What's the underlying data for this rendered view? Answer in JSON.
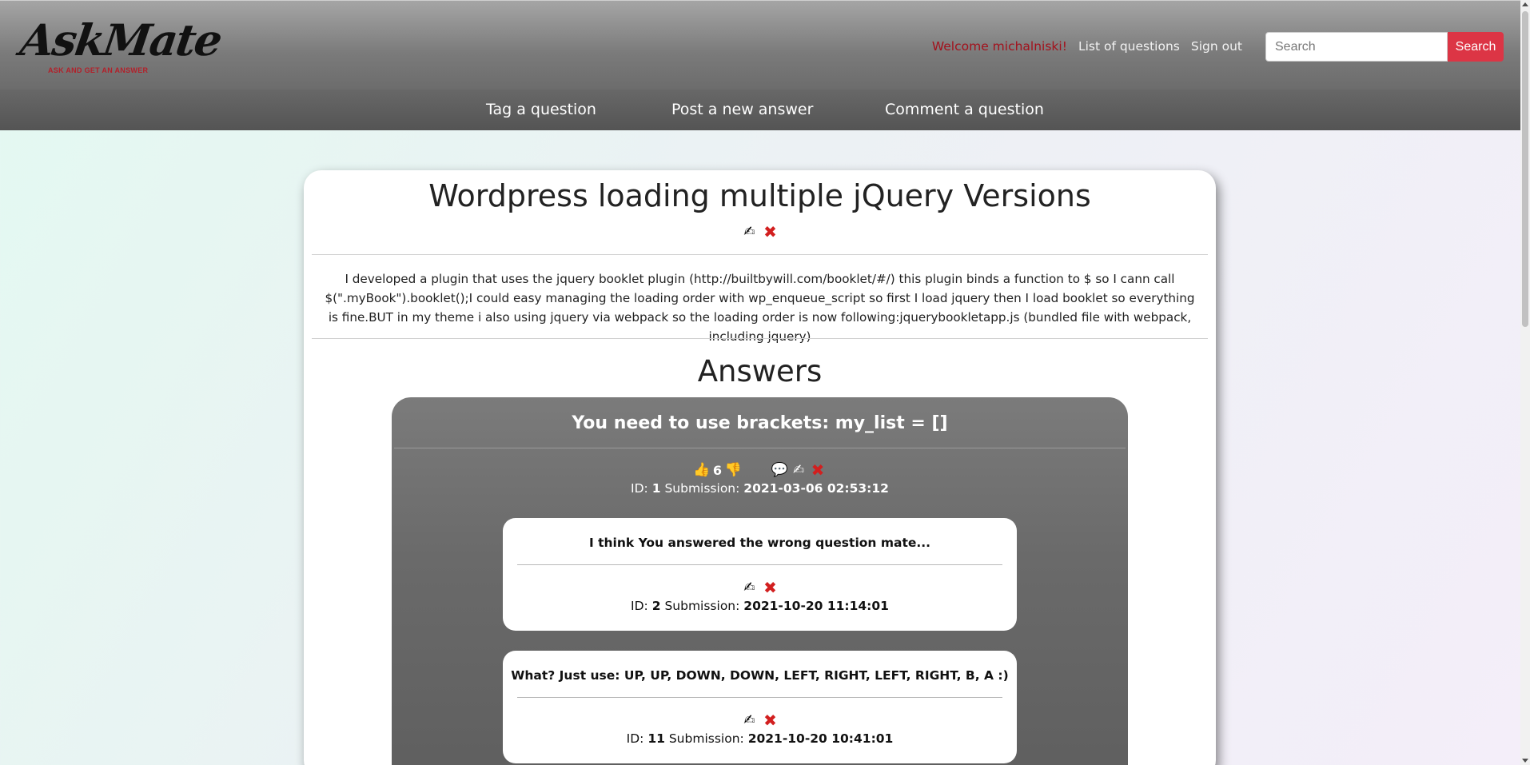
{
  "header": {
    "logo_text": "AskMate",
    "logo_tagline": "ASK AND GET AN ANSWER",
    "welcome": "Welcome michalniski!",
    "list_link": "List of questions",
    "signout_link": "Sign out",
    "search_placeholder": "Search",
    "search_button": "Search"
  },
  "subnav": {
    "tag": "Tag a question",
    "post_answer": "Post a new answer",
    "comment": "Comment a question"
  },
  "question": {
    "title": "Wordpress loading multiple jQuery Versions",
    "body": "I developed a plugin that uses the jquery booklet plugin (http://builtbywill.com/booklet/#/) this plugin binds a function to $ so I cann call $(\".myBook\").booklet();I could easy managing the loading order with wp_enqueue_script so first I load jquery then I load booklet so everything is fine.BUT in my theme i also using jquery via webpack so the loading order is now following:jquerybookletapp.js (bundled file with webpack, including jquery)"
  },
  "answers_heading": "Answers",
  "answer": {
    "title": "You need to use brackets: my_list = []",
    "votes": "6",
    "id_label": "ID:",
    "id": "1",
    "submission_label": "Submission:",
    "submission": "2021-03-06 02:53:12"
  },
  "comments": [
    {
      "text": "I think You answered the wrong question mate...",
      "id_label": "ID:",
      "id": "2",
      "submission_label": "Submission:",
      "submission": "2021-10-20 11:14:01"
    },
    {
      "text": "What? Just use: UP, UP, DOWN, DOWN, LEFT, RIGHT, LEFT, RIGHT, B, A :)",
      "id_label": "ID:",
      "id": "11",
      "submission_label": "Submission:",
      "submission": "2021-10-20 10:41:01"
    }
  ],
  "icons": {
    "edit": "writing-hand-icon",
    "delete": "cross-mark-icon",
    "upvote": "thumbs-up-icon",
    "downvote": "thumbs-down-icon",
    "comment": "speech-bubble-icon"
  },
  "colors": {
    "accent_red": "#dc3545",
    "welcome_red": "#a3111c"
  }
}
